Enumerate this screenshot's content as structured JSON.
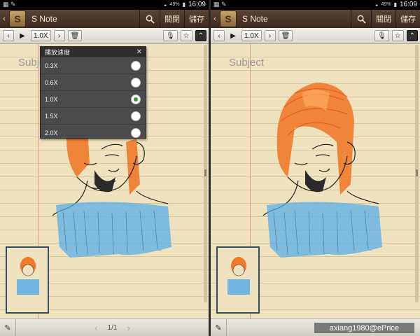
{
  "status": {
    "battery": "49%",
    "time": "16:09"
  },
  "app": {
    "title": "S Note",
    "close_label": "關閉",
    "save_label": "儲存"
  },
  "toolbar": {
    "speed": "1.0X"
  },
  "note": {
    "subject_placeholder": "Subject"
  },
  "pager": {
    "page": "1/1"
  },
  "speed_popup": {
    "title": "播放速度",
    "options": [
      "0.3X",
      "0.6X",
      "1.0X",
      "1.5X",
      "2.0X"
    ],
    "selected": "1.0X"
  },
  "watermark": "axiang1980@ePrice",
  "colors": {
    "hair": "#f07a2a",
    "shirt": "#5aaee8",
    "appbar": "#4a3528",
    "paper": "#efe3bf"
  }
}
